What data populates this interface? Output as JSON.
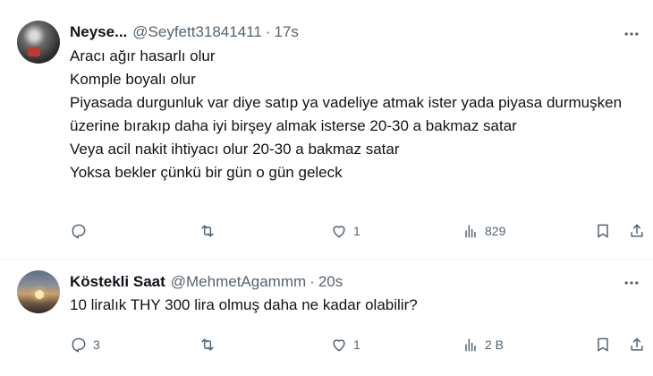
{
  "tweets": [
    {
      "name": "Neyse...",
      "handle": "@Seyfett31841411",
      "separator": "·",
      "time": "17s",
      "lines": [
        "Aracı ağır hasarlı olur",
        "Komple boyalı olur",
        "Piyasada durgunluk var diye satıp ya vadeliye atmak ister yada piyasa durmuşken üzerine bırakıp daha iyi birşey almak isterse 20-30 a bakmaz satar",
        "Veya acil nakit ihtiyacı olur 20-30 a bakmaz satar",
        "Yoksa bekler çünkü bir gün o gün geleck"
      ],
      "reply_count": "",
      "retweet_count": "",
      "like_count": "1",
      "views": "829"
    },
    {
      "name": "Köstekli Saat",
      "handle": "@MehmetAgammm",
      "separator": "·",
      "time": "20s",
      "lines": [
        "10 liralık THY 300 lira olmuş daha ne kadar olabilir?"
      ],
      "reply_count": "3",
      "retweet_count": "",
      "like_count": "1",
      "views": "2 B"
    }
  ],
  "icons": {
    "reply": "reply-icon",
    "retweet": "retweet-icon",
    "like": "heart-icon",
    "views": "views-icon",
    "bookmark": "bookmark-icon",
    "share": "share-icon",
    "more": "more-icon"
  },
  "colors": {
    "text": "#0f1419",
    "muted": "#536471",
    "divider": "#eff3f4"
  }
}
